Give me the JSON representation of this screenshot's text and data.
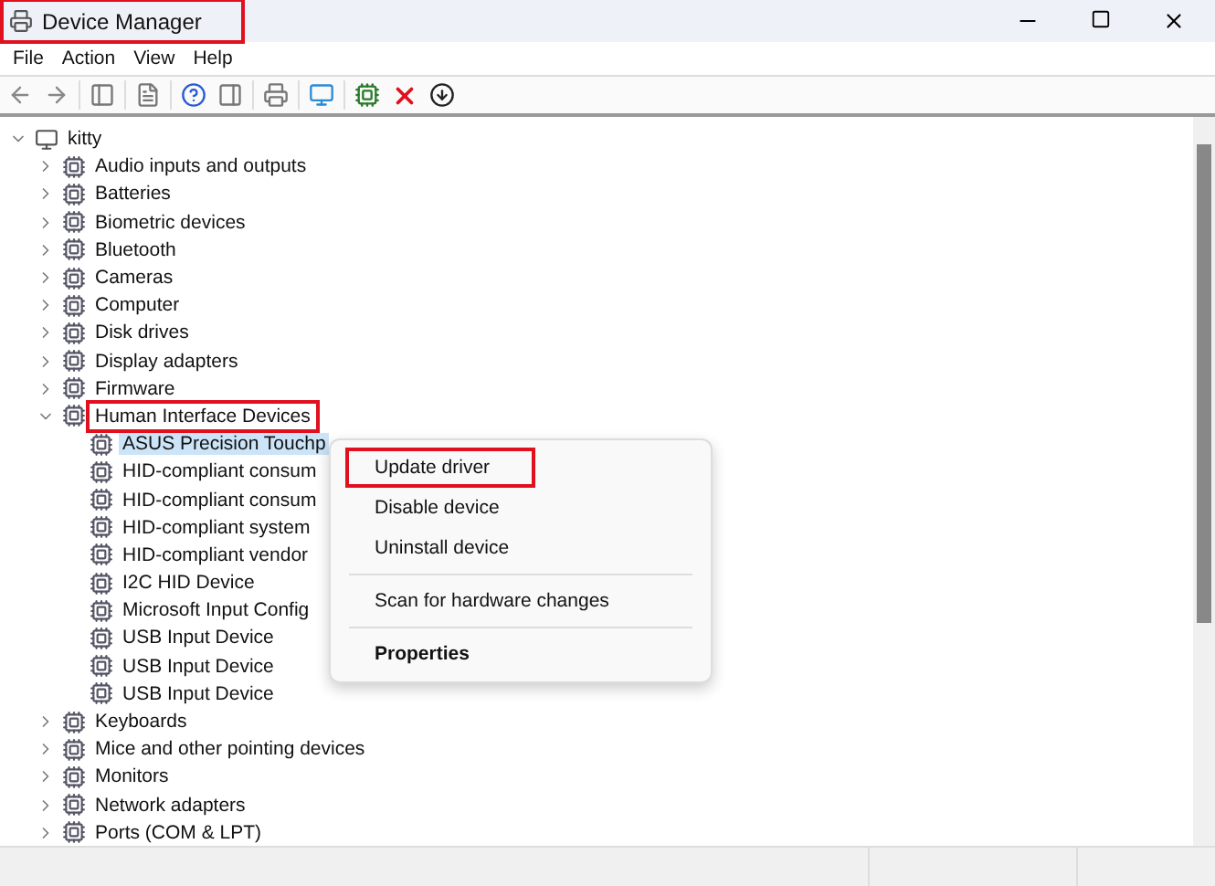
{
  "window": {
    "title": "Device Manager",
    "highlighted": true
  },
  "menu_bar": [
    "File",
    "Action",
    "View",
    "Help"
  ],
  "tree": {
    "label": "kitty",
    "expanded": true,
    "children": [
      {
        "label": "Audio inputs and outputs",
        "expanded": false,
        "highlighted": false
      },
      {
        "label": "Batteries",
        "expanded": false,
        "highlighted": false
      },
      {
        "label": "Biometric devices",
        "expanded": false,
        "highlighted": false
      },
      {
        "label": "Bluetooth",
        "expanded": false,
        "highlighted": false
      },
      {
        "label": "Cameras",
        "expanded": false,
        "highlighted": false
      },
      {
        "label": "Computer",
        "expanded": false,
        "highlighted": false
      },
      {
        "label": "Disk drives",
        "expanded": false,
        "highlighted": false
      },
      {
        "label": "Display adapters",
        "expanded": false,
        "highlighted": false
      },
      {
        "label": "Firmware",
        "expanded": false,
        "highlighted": false
      },
      {
        "label": "Human Interface Devices",
        "expanded": true,
        "highlighted": true,
        "children": [
          {
            "label": "ASUS Precision Touchp",
            "selected": true
          },
          {
            "label": "HID-compliant consum",
            "selected": false
          },
          {
            "label": "HID-compliant consum",
            "selected": false
          },
          {
            "label": "HID-compliant system",
            "selected": false
          },
          {
            "label": "HID-compliant vendor",
            "selected": false
          },
          {
            "label": "I2C HID Device",
            "selected": false
          },
          {
            "label": "Microsoft Input Config",
            "selected": false
          },
          {
            "label": "USB Input Device",
            "selected": false
          },
          {
            "label": "USB Input Device",
            "selected": false
          },
          {
            "label": "USB Input Device",
            "selected": false
          }
        ]
      },
      {
        "label": "Keyboards",
        "expanded": false,
        "highlighted": false
      },
      {
        "label": "Mice and other pointing devices",
        "expanded": false,
        "highlighted": false
      },
      {
        "label": "Monitors",
        "expanded": false,
        "highlighted": false
      },
      {
        "label": "Network adapters",
        "expanded": false,
        "highlighted": false
      },
      {
        "label": "Ports (COM & LPT)",
        "expanded": false,
        "highlighted": false
      }
    ]
  },
  "context_menu": [
    {
      "kind": "item",
      "label": "Update driver",
      "highlighted": true,
      "default": false
    },
    {
      "kind": "item",
      "label": "Disable device",
      "highlighted": false,
      "default": false
    },
    {
      "kind": "item",
      "label": "Uninstall device",
      "highlighted": false,
      "default": false
    },
    {
      "kind": "separator"
    },
    {
      "kind": "item",
      "label": "Scan for hardware changes",
      "highlighted": false,
      "default": false
    },
    {
      "kind": "separator"
    },
    {
      "kind": "item",
      "label": "Properties",
      "highlighted": false,
      "default": true
    }
  ]
}
